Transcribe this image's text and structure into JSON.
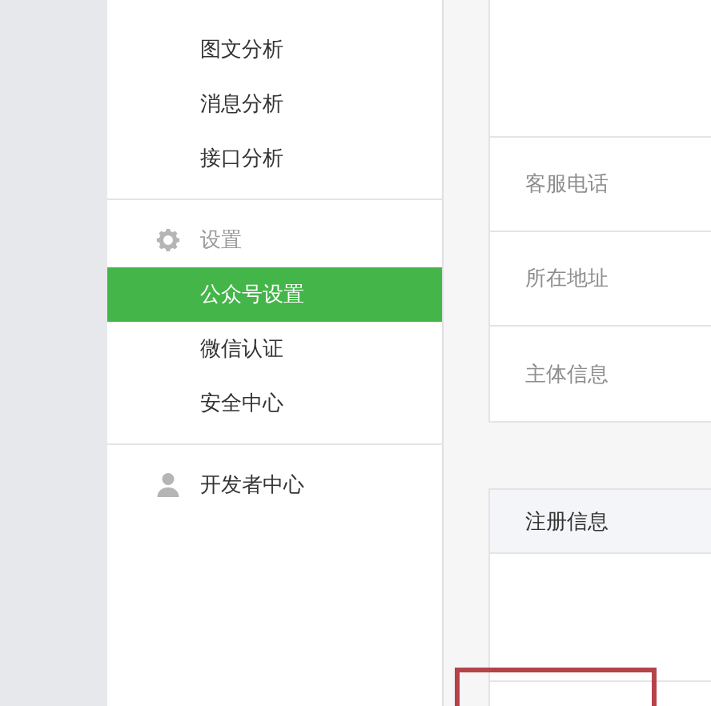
{
  "sidebar": {
    "groups": [
      {
        "items": [
          {
            "label": "图文分析",
            "selected": false
          },
          {
            "label": "消息分析",
            "selected": false
          },
          {
            "label": "接口分析",
            "selected": false
          }
        ]
      },
      {
        "title": "设置",
        "items": [
          {
            "label": "公众号设置",
            "selected": true
          },
          {
            "label": "微信认证",
            "selected": false
          },
          {
            "label": "安全中心",
            "selected": false
          }
        ]
      },
      {
        "title": "开发者中心"
      }
    ]
  },
  "info_rows": [
    {
      "label": "客服电话"
    },
    {
      "label": "所在地址"
    },
    {
      "label": "主体信息"
    }
  ],
  "registration": {
    "title": "注册信息"
  }
}
